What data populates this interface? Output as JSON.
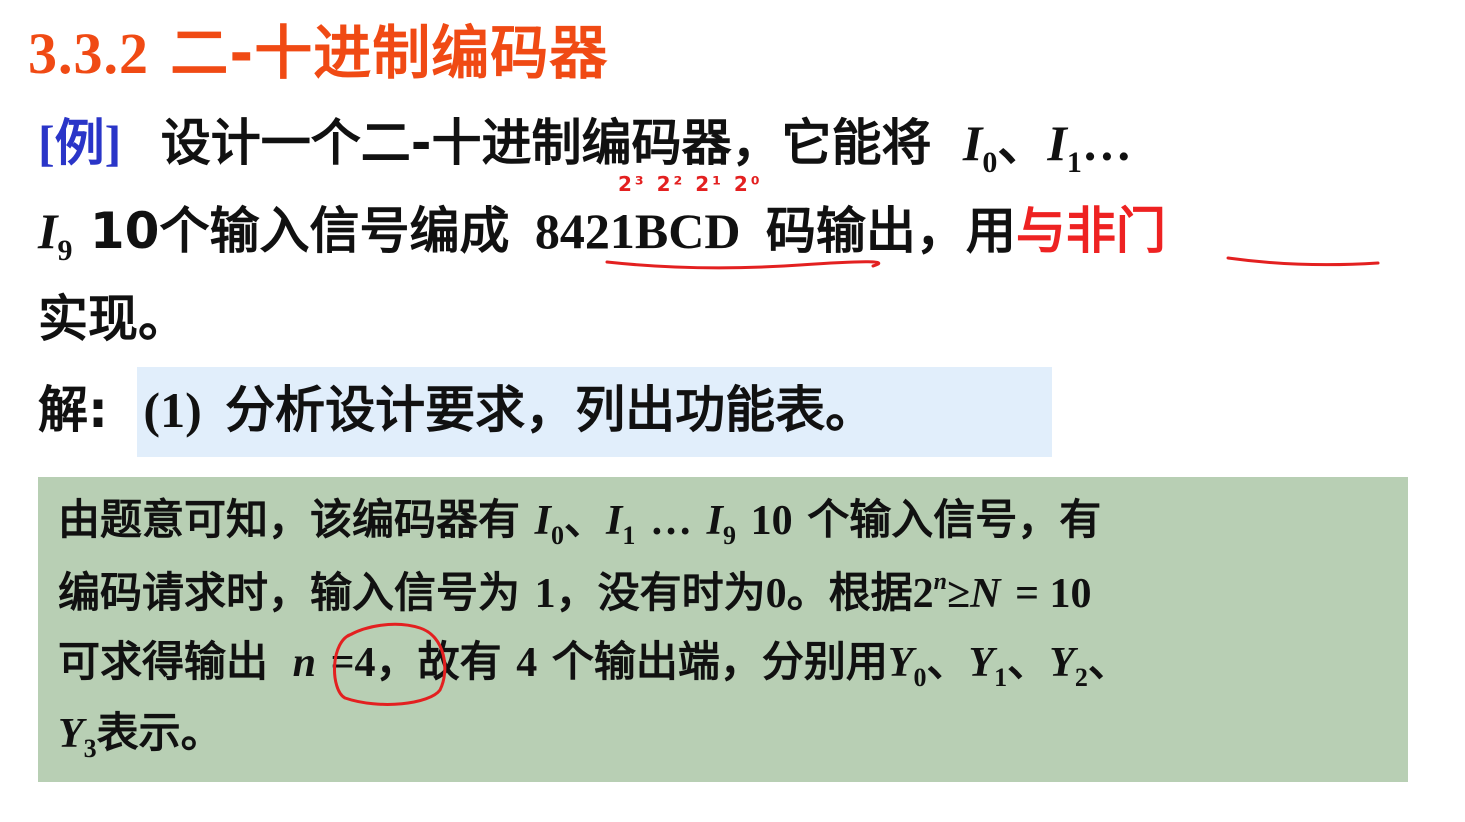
{
  "title": {
    "num": "3.3.2",
    "text": "二-十进制编码器"
  },
  "example": {
    "tag": "[例]",
    "line1_text": "设计一个二-十进制编码器，它能将",
    "I": "I",
    "sub0": "0",
    "sep1": "、",
    "sub1": "1",
    "ellipsis": "…",
    "line2_sub9": "9",
    "line2_text_a": "10个输入信号编成",
    "bcd": "8421BCD",
    "line2_text_b": "码输出，用",
    "nand": "与非门",
    "line3_text": "实现。",
    "annot_powers": "2³ 2² 2¹ 2⁰"
  },
  "solution": {
    "label": "解:",
    "step": "(1)",
    "step_text": "分析设计要求，列出功能表。"
  },
  "box": {
    "l1_a": "由题意可知，该编码器有",
    "l1_b": "10",
    "l1_c": "个输入信号，有",
    "l2_a": "编码请求时，输入信号为",
    "l2_one": "1",
    "l2_b": "，没有时为",
    "l2_zero": "0",
    "l2_c": "。根据",
    "l2_two": "2",
    "l2_n": "n",
    "l2_ge": "≥",
    "l2_N": "N",
    "l2_eq": "= 10",
    "l3_a": "可求得输出",
    "l3_n": "n",
    "l3_eq": "=4",
    "l3_b": "，故有",
    "l3_four": "4",
    "l3_c": "个输出端，分别用",
    "Y": "Y",
    "y0": "0",
    "y1": "1",
    "y2": "2",
    "y3": "3",
    "sep": "、",
    "l4_b": "表示。",
    "I": "I",
    "i0": "0",
    "i1": "1",
    "i9": "9",
    "dots": "…"
  },
  "colors": {
    "title": "#f04a14",
    "tag": "#2a35c8",
    "highlight_red": "#ee2222",
    "box_bg": "#b8cfb4",
    "solution_bg": "#e1eefb"
  }
}
